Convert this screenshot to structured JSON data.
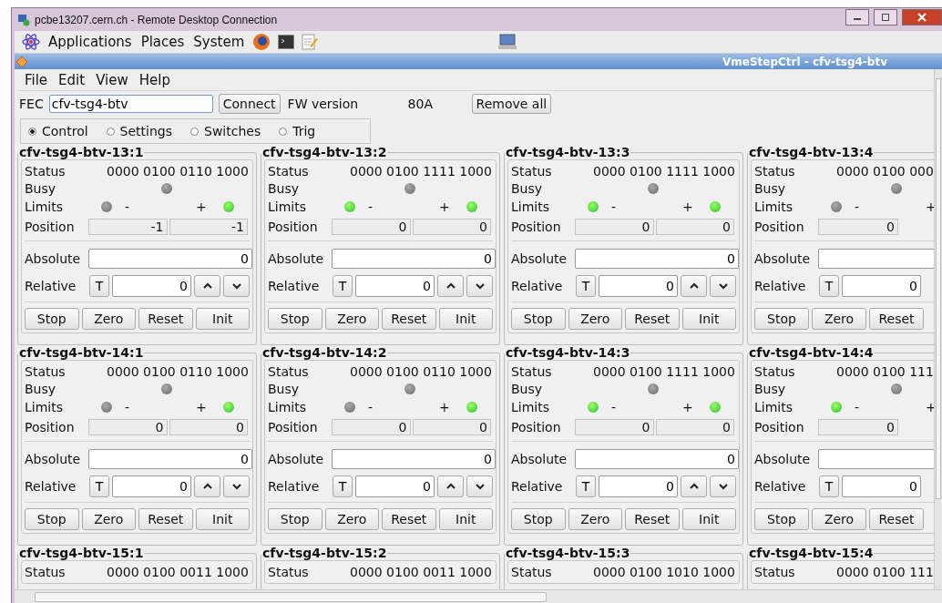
{
  "rdp_window": {
    "title": "pcbe13207.cern.ch - Remote Desktop Connection"
  },
  "desktop_panel": {
    "menus": [
      "Applications",
      "Places",
      "System"
    ]
  },
  "app_window": {
    "title": "VmeStepCtrl -  cfv-tsg4-btv"
  },
  "menu": [
    "File",
    "Edit",
    "View",
    "Help"
  ],
  "toolbar": {
    "fec_label": "FEC",
    "fec_value": "cfv-tsg4-btv",
    "connect": "Connect",
    "fw_label": "FW version",
    "fw_value": "80A",
    "remove_all": "Remove all"
  },
  "modes": [
    {
      "label": "Control",
      "selected": true
    },
    {
      "label": "Settings",
      "selected": false
    },
    {
      "label": "Switches",
      "selected": false
    },
    {
      "label": "Trig",
      "selected": false
    }
  ],
  "panels": [
    {
      "title": "cfv-tsg4-btv-13:1",
      "rows": [
        {
          "kind": "status",
          "label": "Status",
          "value": "0000 0100 0110 1000"
        },
        {
          "kind": "busy",
          "label": "Busy",
          "on": false
        },
        {
          "kind": "limits",
          "label": "Limits",
          "minus": {
            "sign": "-",
            "on": false
          },
          "plus": {
            "sign": "+",
            "on": true
          }
        },
        {
          "kind": "position",
          "label": "Position",
          "values": [
            "-1",
            "-1"
          ]
        },
        {
          "kind": "absolute",
          "label": "Absolute",
          "value": "0"
        },
        {
          "kind": "relative",
          "label": "Relative",
          "toggle": "T",
          "value": "0",
          "steppers": true
        }
      ],
      "buttons": [
        "Stop",
        "Zero",
        "Reset",
        "Init"
      ]
    },
    {
      "title": "cfv-tsg4-btv-13:2",
      "rows": [
        {
          "kind": "status",
          "label": "Status",
          "value": "0000 0100 1111 1000"
        },
        {
          "kind": "busy",
          "label": "Busy",
          "on": false
        },
        {
          "kind": "limits",
          "label": "Limits",
          "minus": {
            "sign": "-",
            "on": true
          },
          "plus": {
            "sign": "+",
            "on": true
          }
        },
        {
          "kind": "position",
          "label": "Position",
          "values": [
            "0",
            "0"
          ]
        },
        {
          "kind": "absolute",
          "label": "Absolute",
          "value": "0"
        },
        {
          "kind": "relative",
          "label": "Relative",
          "toggle": "T",
          "value": "0",
          "steppers": true
        }
      ],
      "buttons": [
        "Stop",
        "Zero",
        "Reset",
        "Init"
      ]
    },
    {
      "title": "cfv-tsg4-btv-13:3",
      "rows": [
        {
          "kind": "status",
          "label": "Status",
          "value": "0000 0100 1111 1000"
        },
        {
          "kind": "busy",
          "label": "Busy",
          "on": false
        },
        {
          "kind": "limits",
          "label": "Limits",
          "minus": {
            "sign": "-",
            "on": true
          },
          "plus": {
            "sign": "+",
            "on": true
          }
        },
        {
          "kind": "position",
          "label": "Position",
          "values": [
            "0",
            "0"
          ]
        },
        {
          "kind": "absolute",
          "label": "Absolute",
          "value": "0"
        },
        {
          "kind": "relative",
          "label": "Relative",
          "toggle": "T",
          "value": "0",
          "steppers": true
        }
      ],
      "buttons": [
        "Stop",
        "Zero",
        "Reset",
        "Init"
      ]
    },
    {
      "title": "cfv-tsg4-btv-13:4",
      "rows": [
        {
          "kind": "status",
          "label": "Status",
          "value": "0000 0100 000"
        },
        {
          "kind": "busy",
          "label": "Busy",
          "on": false
        },
        {
          "kind": "limits",
          "label": "Limits",
          "minus": {
            "sign": "-",
            "on": false
          },
          "plus": {
            "sign": "+"
          }
        },
        {
          "kind": "position",
          "label": "Position",
          "values": [
            "0"
          ]
        },
        {
          "kind": "absolute",
          "label": "Absolute"
        },
        {
          "kind": "relative",
          "label": "Relative",
          "toggle": "T",
          "value": "0",
          "steppers": false
        }
      ],
      "buttons": [
        "Stop",
        "Zero",
        "Reset"
      ]
    },
    {
      "title": "cfv-tsg4-btv-14:1",
      "rows": [
        {
          "kind": "status",
          "label": "Status",
          "value": "0000 0100 0110 1000"
        },
        {
          "kind": "busy",
          "label": "Busy",
          "on": false
        },
        {
          "kind": "limits",
          "label": "Limits",
          "minus": {
            "sign": "-",
            "on": false
          },
          "plus": {
            "sign": "+",
            "on": true
          }
        },
        {
          "kind": "position",
          "label": "Position",
          "values": [
            "0",
            "0"
          ]
        },
        {
          "kind": "absolute",
          "label": "Absolute",
          "value": "0"
        },
        {
          "kind": "relative",
          "label": "Relative",
          "toggle": "T",
          "value": "0",
          "steppers": true
        }
      ],
      "buttons": [
        "Stop",
        "Zero",
        "Reset",
        "Init"
      ]
    },
    {
      "title": "cfv-tsg4-btv-14:2",
      "rows": [
        {
          "kind": "status",
          "label": "Status",
          "value": "0000 0100 0110 1000"
        },
        {
          "kind": "busy",
          "label": "Busy",
          "on": false
        },
        {
          "kind": "limits",
          "label": "Limits",
          "minus": {
            "sign": "-",
            "on": false
          },
          "plus": {
            "sign": "+",
            "on": true
          }
        },
        {
          "kind": "position",
          "label": "Position",
          "values": [
            "0",
            "0"
          ]
        },
        {
          "kind": "absolute",
          "label": "Absolute",
          "value": "0"
        },
        {
          "kind": "relative",
          "label": "Relative",
          "toggle": "T",
          "value": "0",
          "steppers": true
        }
      ],
      "buttons": [
        "Stop",
        "Zero",
        "Reset",
        "Init"
      ]
    },
    {
      "title": "cfv-tsg4-btv-14:3",
      "rows": [
        {
          "kind": "status",
          "label": "Status",
          "value": "0000 0100 1111 1000"
        },
        {
          "kind": "busy",
          "label": "Busy",
          "on": false
        },
        {
          "kind": "limits",
          "label": "Limits",
          "minus": {
            "sign": "-",
            "on": true
          },
          "plus": {
            "sign": "+",
            "on": true
          }
        },
        {
          "kind": "position",
          "label": "Position",
          "values": [
            "0",
            "0"
          ]
        },
        {
          "kind": "absolute",
          "label": "Absolute",
          "value": "0"
        },
        {
          "kind": "relative",
          "label": "Relative",
          "toggle": "T",
          "value": "0",
          "steppers": true
        }
      ],
      "buttons": [
        "Stop",
        "Zero",
        "Reset",
        "Init"
      ]
    },
    {
      "title": "cfv-tsg4-btv-14:4",
      "rows": [
        {
          "kind": "status",
          "label": "Status",
          "value": "0000 0100 111"
        },
        {
          "kind": "busy",
          "label": "Busy",
          "on": false
        },
        {
          "kind": "limits",
          "label": "Limits",
          "minus": {
            "sign": "-",
            "on": true
          },
          "plus": {
            "sign": "+"
          }
        },
        {
          "kind": "position",
          "label": "Position",
          "values": [
            "0"
          ]
        },
        {
          "kind": "absolute",
          "label": "Absolute"
        },
        {
          "kind": "relative",
          "label": "Relative",
          "toggle": "T",
          "value": "0",
          "steppers": false
        }
      ],
      "buttons": [
        "Stop",
        "Zero",
        "Reset"
      ]
    },
    {
      "title": "cfv-tsg4-btv-15:1",
      "rows": [
        {
          "kind": "status",
          "label": "Status",
          "value": "0000 0100 0011 1000"
        }
      ]
    },
    {
      "title": "cfv-tsg4-btv-15:2",
      "rows": [
        {
          "kind": "status",
          "label": "Status",
          "value": "0000 0100 0011 1000"
        }
      ]
    },
    {
      "title": "cfv-tsg4-btv-15:3",
      "rows": [
        {
          "kind": "status",
          "label": "Status",
          "value": "0000 0100 1010 1000"
        }
      ]
    },
    {
      "title": "cfv-tsg4-btv-15:4",
      "rows": [
        {
          "kind": "status",
          "label": "Status",
          "value": "0000 0100 111"
        }
      ]
    }
  ]
}
